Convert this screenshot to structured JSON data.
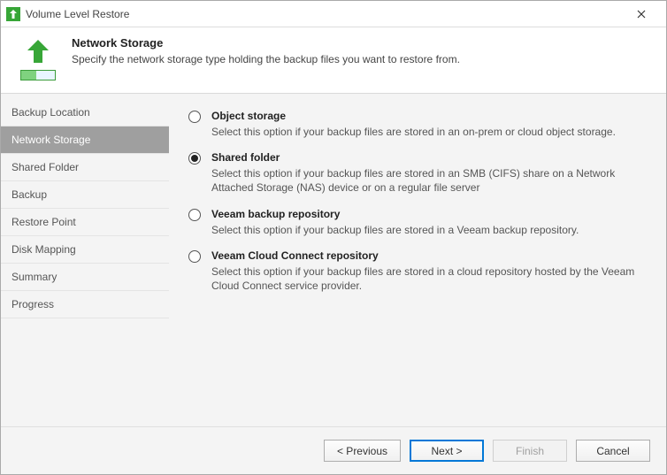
{
  "window": {
    "title": "Volume Level Restore"
  },
  "header": {
    "title": "Network Storage",
    "subtitle": "Specify the network storage type holding the backup files you want to restore from."
  },
  "sidebar": {
    "items": [
      {
        "label": "Backup Location",
        "selected": false
      },
      {
        "label": "Network Storage",
        "selected": true
      },
      {
        "label": "Shared Folder",
        "selected": false
      },
      {
        "label": "Backup",
        "selected": false
      },
      {
        "label": "Restore Point",
        "selected": false
      },
      {
        "label": "Disk Mapping",
        "selected": false
      },
      {
        "label": "Summary",
        "selected": false
      },
      {
        "label": "Progress",
        "selected": false
      }
    ]
  },
  "options": [
    {
      "title": "Object storage",
      "desc": "Select this option if your backup files are stored in an on-prem or cloud object storage.",
      "selected": false
    },
    {
      "title": "Shared folder",
      "desc": "Select this option if your backup files are stored in an SMB (CIFS) share on a Network Attached Storage (NAS) device or on a regular file server",
      "selected": true
    },
    {
      "title": "Veeam backup repository",
      "desc": "Select this option if your backup files are stored in a Veeam backup repository.",
      "selected": false
    },
    {
      "title": "Veeam Cloud Connect repository",
      "desc": "Select this option if your backup files are stored in a cloud repository hosted by the Veeam Cloud Connect service provider.",
      "selected": false
    }
  ],
  "buttons": {
    "previous": "< Previous",
    "next": "Next >",
    "finish": "Finish",
    "cancel": "Cancel",
    "finish_disabled": true
  }
}
